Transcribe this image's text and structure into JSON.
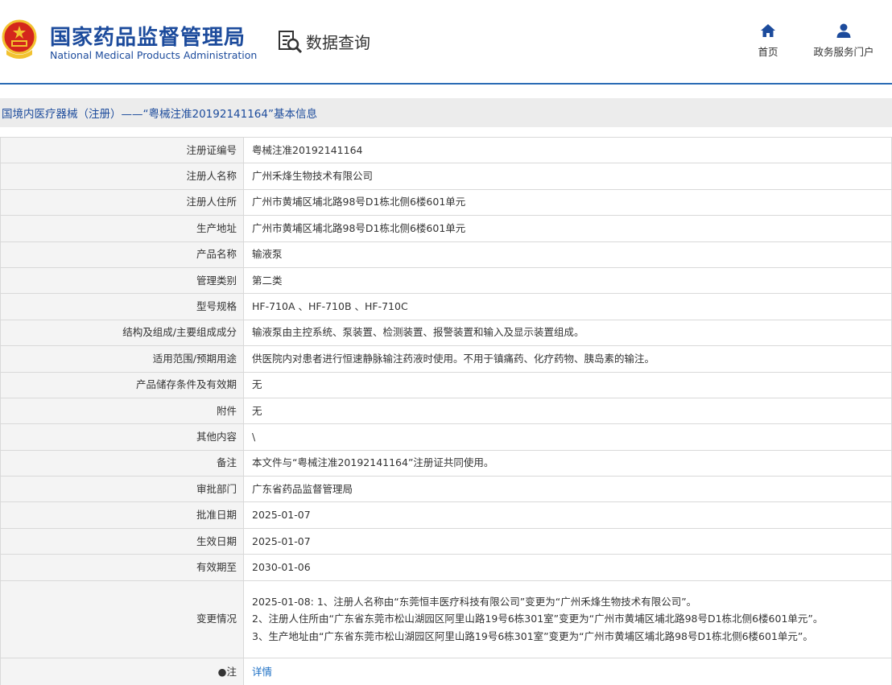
{
  "header": {
    "logo_cn": "国家药品监督管理局",
    "logo_en": "National Medical Products Administration",
    "section_title": "数据查询",
    "nav": [
      {
        "label": "首页",
        "icon": "home-icon"
      },
      {
        "label": "政务服务门户",
        "icon": "user-icon"
      }
    ]
  },
  "colors": {
    "brand_blue": "#1c4b9c",
    "divider_blue": "#2a6bb5",
    "emblem_red": "#d4261c",
    "emblem_gold": "#f2c230",
    "link_blue": "#1c6fc4"
  },
  "page_title": "国境内医疗器械（注册）——“粤械注准20192141164”基本信息",
  "rows": [
    {
      "key": "注册证编号",
      "value": "粤械注准20192141164"
    },
    {
      "key": "注册人名称",
      "value": "广州禾烽生物技术有限公司"
    },
    {
      "key": "注册人住所",
      "value": "广州市黄埔区埔北路98号D1栋北侧6楼601单元"
    },
    {
      "key": "生产地址",
      "value": "广州市黄埔区埔北路98号D1栋北侧6楼601单元"
    },
    {
      "key": "产品名称",
      "value": "输液泵"
    },
    {
      "key": "管理类别",
      "value": "第二类"
    },
    {
      "key": "型号规格",
      "value": "HF-710A 、HF-710B 、HF-710C"
    },
    {
      "key": "结构及组成/主要组成成分",
      "value": "输液泵由主控系统、泵装置、检测装置、报警装置和输入及显示装置组成。"
    },
    {
      "key": "适用范围/预期用途",
      "value": "供医院内对患者进行恒速静脉输注药液时使用。不用于镇痛药、化疗药物、胰岛素的输注。"
    },
    {
      "key": "产品储存条件及有效期",
      "value": "无"
    },
    {
      "key": "附件",
      "value": "无"
    },
    {
      "key": "其他内容",
      "value": "\\"
    },
    {
      "key": "备注",
      "value": "本文件与“粤械注准20192141164”注册证共同使用。"
    },
    {
      "key": "审批部门",
      "value": "广东省药品监督管理局"
    },
    {
      "key": "批准日期",
      "value": "2025-01-07"
    },
    {
      "key": "生效日期",
      "value": "2025-01-07"
    },
    {
      "key": "有效期至",
      "value": "2030-01-06"
    }
  ],
  "change": {
    "key": "变更情况",
    "lines": [
      "2025-01-08: 1、注册人名称由“东莞恒丰医疗科技有限公司”变更为“广州禾烽生物技术有限公司”。",
      "2、注册人住所由“广东省东莞市松山湖园区阿里山路19号6栋301室”变更为“广州市黄埔区埔北路98号D1栋北侧6楼601单元”。",
      "3、生产地址由“广东省东莞市松山湖园区阿里山路19号6栋301室”变更为“广州市黄埔区埔北路98号D1栋北侧6楼601单元”。"
    ]
  },
  "note": {
    "key": "●注",
    "link": "详情"
  }
}
